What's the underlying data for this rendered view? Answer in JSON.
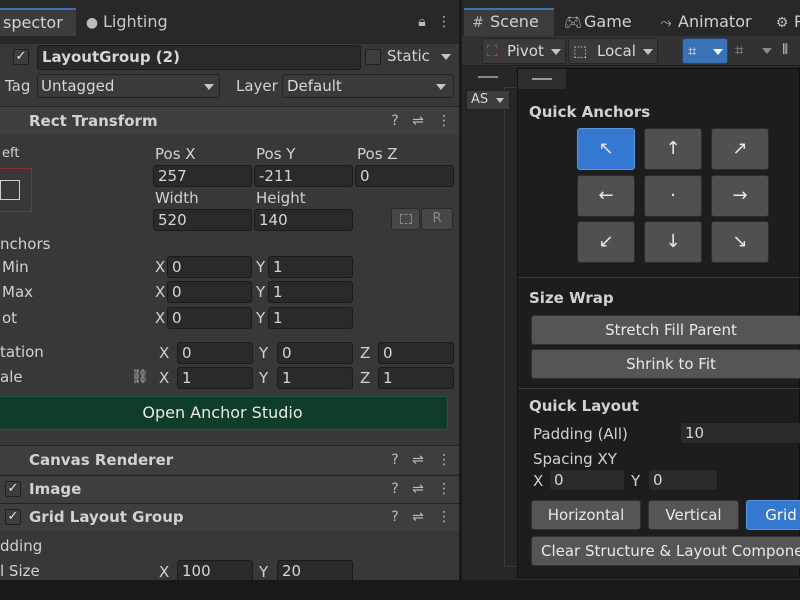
{
  "inspector": {
    "tabs": [
      {
        "label": "spector",
        "icon": "inspector-icon"
      },
      {
        "label": "Lighting",
        "icon": "lightbulb-icon"
      }
    ],
    "object": {
      "name": "LayoutGroup (2)",
      "active": true,
      "static_label": "Static",
      "static": false
    },
    "tag": {
      "label": "Tag",
      "value": "Untagged"
    },
    "layer": {
      "label": "Layer",
      "value": "Default"
    },
    "rect_transform": {
      "title": "Rect Transform",
      "anchor_label": "eft",
      "pos_x": {
        "label": "Pos X",
        "value": "257"
      },
      "pos_y": {
        "label": "Pos Y",
        "value": "-211"
      },
      "pos_z": {
        "label": "Pos Z",
        "value": "0"
      },
      "width": {
        "label": "Width",
        "value": "520"
      },
      "height": {
        "label": "Height",
        "value": "140"
      },
      "raw_label": "R",
      "anchors_label": "nchors",
      "min": {
        "label": "Min",
        "x": "0",
        "y": "1"
      },
      "max": {
        "label": "Max",
        "x": "0",
        "y": "1"
      },
      "pivot": {
        "label": "ot",
        "x": "0",
        "y": "1"
      },
      "rotation": {
        "label": "tation",
        "x": "0",
        "y": "0",
        "z": "0"
      },
      "scale": {
        "label": "ale",
        "x": "1",
        "y": "1",
        "z": "1"
      },
      "axis": {
        "x": "X",
        "y": "Y",
        "z": "Z"
      }
    },
    "open_anchor_studio": "Open Anchor Studio",
    "components": [
      {
        "name": "Canvas Renderer",
        "checkbox": false
      },
      {
        "name": "Image",
        "checkbox": true
      },
      {
        "name": "Grid Layout Group",
        "checkbox": true
      }
    ],
    "grid": {
      "padding_label": "dding",
      "cell_size_label": "l Size",
      "cell_x": "100",
      "cell_y": "20"
    }
  },
  "scene": {
    "tabs": [
      {
        "label": "Scene",
        "icon": "hash-grid-icon"
      },
      {
        "label": "Game",
        "icon": "gamepad-icon"
      },
      {
        "label": "Animator",
        "icon": "animator-icon"
      },
      {
        "label": "P",
        "icon": "gear-icon"
      }
    ],
    "toolbar": {
      "pivot": "Pivot",
      "local": "Local"
    },
    "as_label": "AS"
  },
  "popup": {
    "quick_anchors": "Quick Anchors",
    "anchor_arrows": [
      "↖",
      "↑",
      "↗",
      "←",
      "·",
      "→",
      "↙",
      "↓",
      "↘"
    ],
    "selected_anchor": 0,
    "size_wrap": "Size Wrap",
    "stretch_fill": "Stretch Fill Parent",
    "shrink_fit": "Shrink to Fit",
    "quick_layout": "Quick Layout",
    "padding": {
      "label": "Padding (All)",
      "value": "10"
    },
    "spacing": {
      "label": "Spacing XY",
      "x_label": "X",
      "x": "0",
      "y_label": "Y",
      "y": "0"
    },
    "layout_buttons": [
      "Horizontal",
      "Vertical",
      "Grid"
    ],
    "selected_layout": "Grid",
    "clear": "Clear Structure & Layout Components"
  },
  "colors": {
    "accent": "#3a72b8",
    "anchor_selected": "#3478d1",
    "studio_button": "#0f3d2a",
    "panel": "#383838",
    "popup": "#1d1d1d"
  }
}
